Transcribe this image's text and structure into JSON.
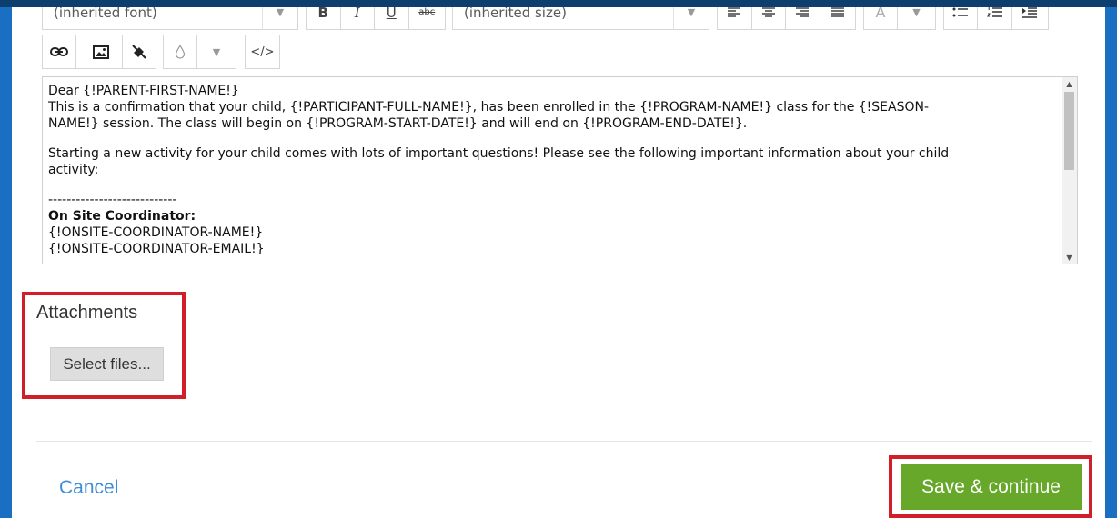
{
  "toolbar": {
    "font_select": "(inherited font)",
    "size_select": "(inherited size)",
    "bold": "B",
    "italic": "I",
    "underline": "U",
    "strike": "abc",
    "font_color": "A",
    "code": "</>"
  },
  "editor": {
    "lines": {
      "l1": "Dear {!PARENT-FIRST-NAME!}",
      "l2": "This is a confirmation that your child, {!PARTICIPANT-FULL-NAME!}, has been enrolled in the {!PROGRAM-NAME!} class for the {!SEASON-",
      "l3": "NAME!} session. The class will begin on {!PROGRAM-START-DATE!} and will end on {!PROGRAM-END-DATE!}.",
      "l4": "Starting a new activity for your child comes with lots of important questions! Please see the following important information about your child",
      "l5": "activity:",
      "l6": "----------------------------",
      "l7": "On Site Coordinator:",
      "l8": "{!ONSITE-COORDINATOR-NAME!}",
      "l9": "{!ONSITE-COORDINATOR-EMAIL!}"
    }
  },
  "attachments": {
    "title": "Attachments",
    "select_files": "Select files..."
  },
  "footer": {
    "cancel": "Cancel",
    "save": "Save & continue"
  },
  "colors": {
    "save_bg": "#67a82b",
    "cancel_link": "#3d8ed6",
    "highlight": "#d11f2a",
    "frame": "#1a6fc2"
  }
}
